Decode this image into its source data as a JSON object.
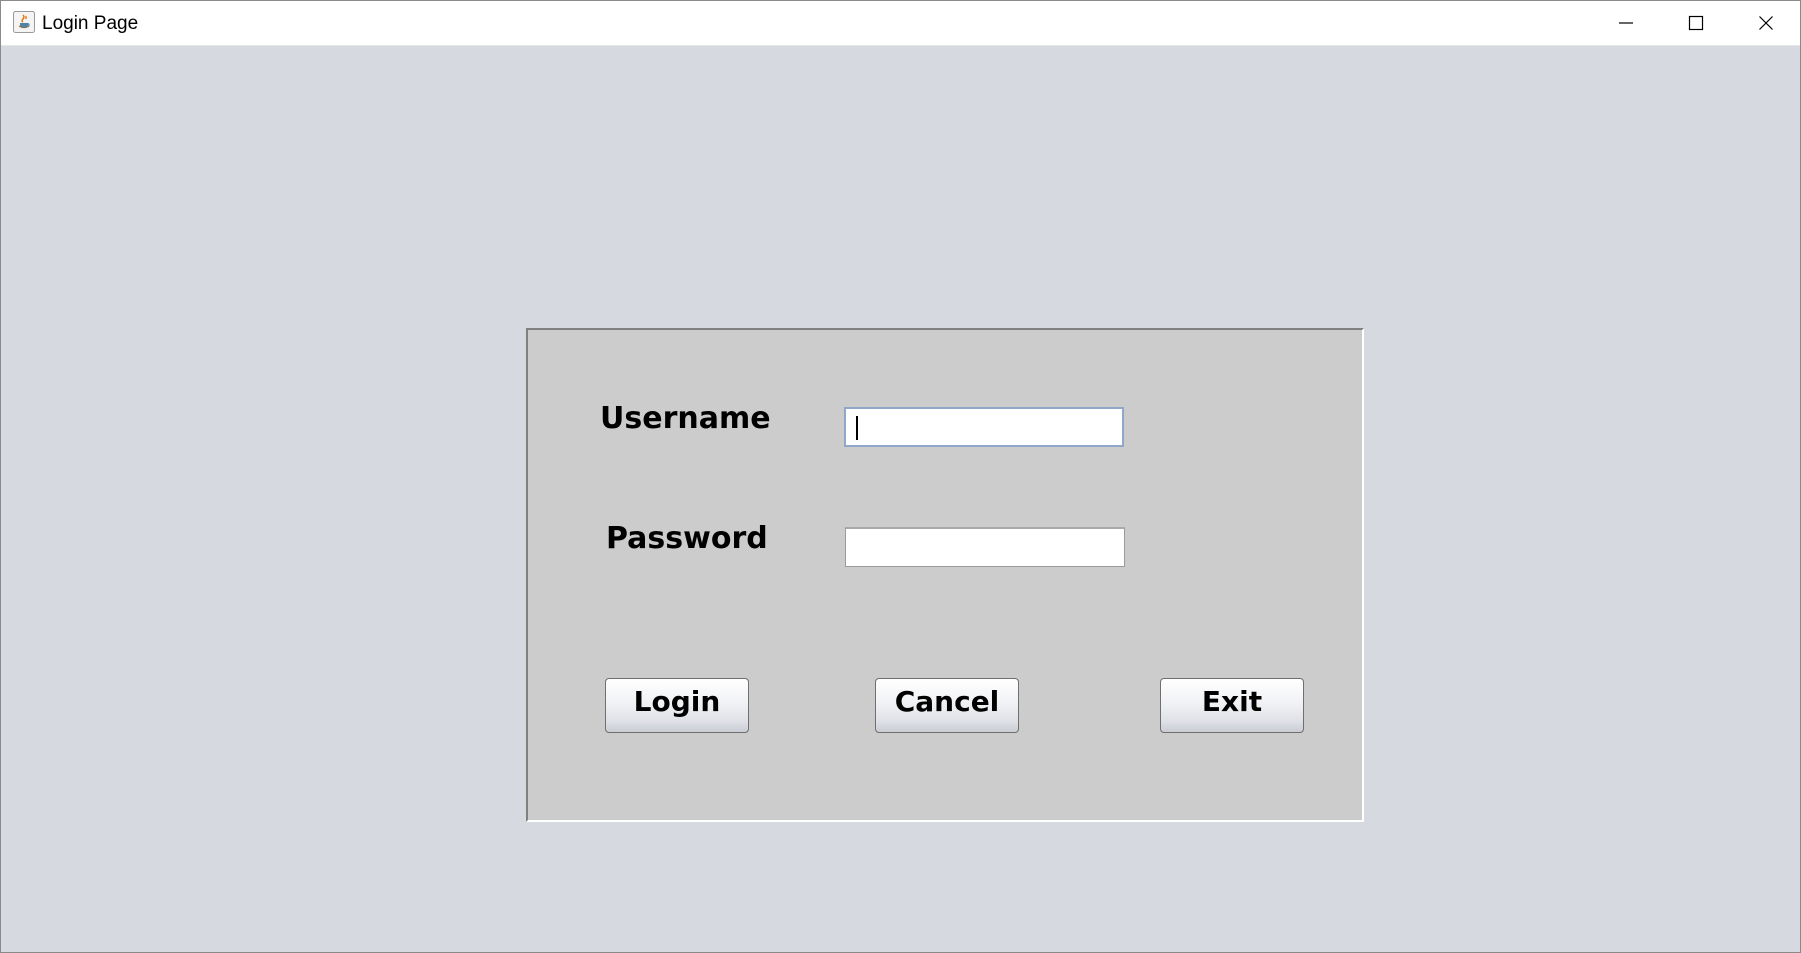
{
  "window": {
    "title": "Login Page",
    "app_icon": "java-icon",
    "controls": {
      "minimize_icon": "minimize-icon",
      "maximize_icon": "maximize-icon",
      "close_icon": "close-icon"
    }
  },
  "form": {
    "username_label": "Username",
    "password_label": "Password",
    "username_value": "",
    "password_value": ""
  },
  "buttons": {
    "login": "Login",
    "cancel": "Cancel",
    "exit": "Exit"
  },
  "colors": {
    "background": "#d6d9e0",
    "panel": "#cccccc",
    "focus_border": "#8fa8c9"
  }
}
